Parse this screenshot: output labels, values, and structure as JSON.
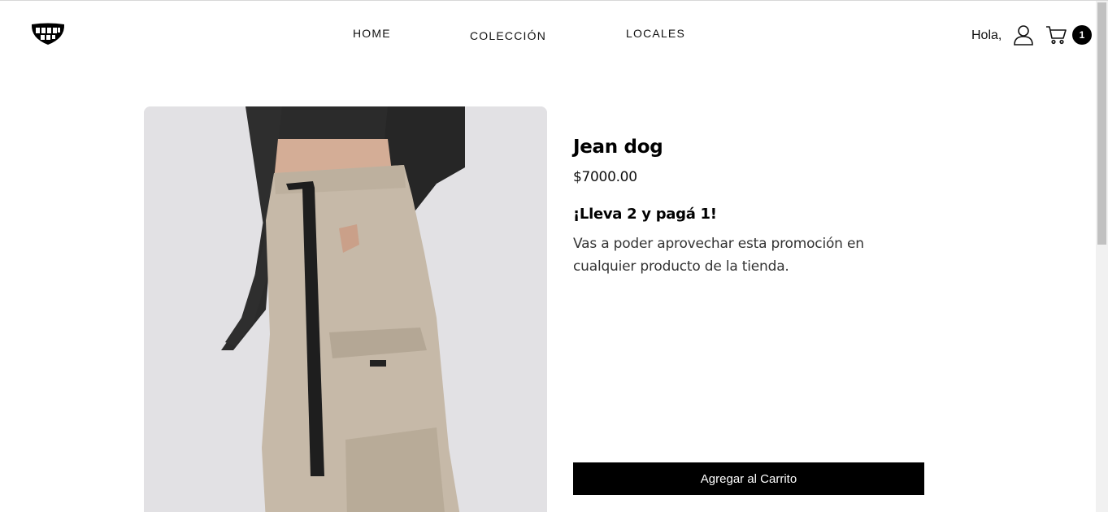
{
  "header": {
    "logo_icon": "smile-teeth-logo-icon",
    "nav": [
      {
        "label": "HOME"
      },
      {
        "label": "COLECCIÓN"
      },
      {
        "label": "LOCALES"
      }
    ],
    "greeting": "Hola,",
    "user_icon": "user-icon",
    "cart_icon": "cart-icon",
    "cart_count": "1"
  },
  "product": {
    "title": "Jean dog",
    "price": "$7000.00",
    "promo_title": "¡Lleva 2 y pagá 1!",
    "promo_description": "Vas a poder aprovechar esta promoción en cualquier producto de la tienda.",
    "add_to_cart_label": "Agregar al Carrito"
  },
  "colors": {
    "accent": "#000000",
    "background": "#ffffff",
    "image_background": "#e2e1e4"
  }
}
